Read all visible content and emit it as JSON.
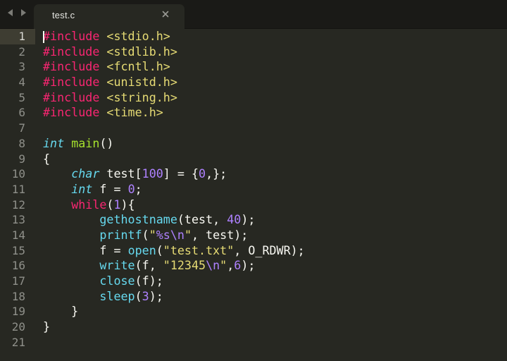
{
  "tab": {
    "title": "test.c",
    "close_glyph": "×"
  },
  "icons": {
    "back": "back-arrow-icon",
    "forward": "forward-arrow-icon",
    "close": "close-icon"
  },
  "editor": {
    "current_line": 1,
    "lines": [
      {
        "n": "1",
        "tokens": [
          {
            "t": "#include ",
            "c": "kw"
          },
          {
            "t": "<stdio.h>",
            "c": "str"
          }
        ]
      },
      {
        "n": "2",
        "tokens": [
          {
            "t": "#include ",
            "c": "kw"
          },
          {
            "t": "<stdlib.h>",
            "c": "str"
          }
        ]
      },
      {
        "n": "3",
        "tokens": [
          {
            "t": "#include ",
            "c": "kw"
          },
          {
            "t": "<fcntl.h>",
            "c": "str"
          }
        ]
      },
      {
        "n": "4",
        "tokens": [
          {
            "t": "#include ",
            "c": "kw"
          },
          {
            "t": "<unistd.h>",
            "c": "str"
          }
        ]
      },
      {
        "n": "5",
        "tokens": [
          {
            "t": "#include ",
            "c": "kw"
          },
          {
            "t": "<string.h>",
            "c": "str"
          }
        ]
      },
      {
        "n": "6",
        "tokens": [
          {
            "t": "#include ",
            "c": "kw"
          },
          {
            "t": "<time.h>",
            "c": "str"
          }
        ]
      },
      {
        "n": "7",
        "tokens": []
      },
      {
        "n": "8",
        "tokens": [
          {
            "t": "int",
            "c": "type"
          },
          {
            "t": " ",
            "c": "txt"
          },
          {
            "t": "main",
            "c": "fn"
          },
          {
            "t": "()",
            "c": "txt"
          }
        ]
      },
      {
        "n": "9",
        "tokens": [
          {
            "t": "{",
            "c": "txt"
          }
        ]
      },
      {
        "n": "10",
        "tokens": [
          {
            "t": "    ",
            "c": "txt"
          },
          {
            "t": "char",
            "c": "type"
          },
          {
            "t": " test[",
            "c": "txt"
          },
          {
            "t": "100",
            "c": "num"
          },
          {
            "t": "] = {",
            "c": "txt"
          },
          {
            "t": "0",
            "c": "num"
          },
          {
            "t": ",};",
            "c": "txt"
          }
        ]
      },
      {
        "n": "11",
        "tokens": [
          {
            "t": "    ",
            "c": "txt"
          },
          {
            "t": "int",
            "c": "type"
          },
          {
            "t": " f = ",
            "c": "txt"
          },
          {
            "t": "0",
            "c": "num"
          },
          {
            "t": ";",
            "c": "txt"
          }
        ]
      },
      {
        "n": "12",
        "tokens": [
          {
            "t": "    ",
            "c": "txt"
          },
          {
            "t": "while",
            "c": "kw"
          },
          {
            "t": "(",
            "c": "txt"
          },
          {
            "t": "1",
            "c": "num"
          },
          {
            "t": "){",
            "c": "txt"
          }
        ]
      },
      {
        "n": "13",
        "tokens": [
          {
            "t": "        ",
            "c": "txt"
          },
          {
            "t": "gethostname",
            "c": "call"
          },
          {
            "t": "(test, ",
            "c": "txt"
          },
          {
            "t": "40",
            "c": "num"
          },
          {
            "t": ");",
            "c": "txt"
          }
        ]
      },
      {
        "n": "14",
        "tokens": [
          {
            "t": "        ",
            "c": "txt"
          },
          {
            "t": "printf",
            "c": "call"
          },
          {
            "t": "(",
            "c": "txt"
          },
          {
            "t": "\"",
            "c": "str"
          },
          {
            "t": "%s\\n",
            "c": "num"
          },
          {
            "t": "\"",
            "c": "str"
          },
          {
            "t": ", test);",
            "c": "txt"
          }
        ]
      },
      {
        "n": "15",
        "tokens": [
          {
            "t": "        f = ",
            "c": "txt"
          },
          {
            "t": "open",
            "c": "call"
          },
          {
            "t": "(",
            "c": "txt"
          },
          {
            "t": "\"test.txt\"",
            "c": "str"
          },
          {
            "t": ", O_RDWR);",
            "c": "txt"
          }
        ]
      },
      {
        "n": "16",
        "tokens": [
          {
            "t": "        ",
            "c": "txt"
          },
          {
            "t": "write",
            "c": "call"
          },
          {
            "t": "(f, ",
            "c": "txt"
          },
          {
            "t": "\"12345",
            "c": "str"
          },
          {
            "t": "\\n",
            "c": "num"
          },
          {
            "t": "\"",
            "c": "str"
          },
          {
            "t": ",",
            "c": "txt"
          },
          {
            "t": "6",
            "c": "num"
          },
          {
            "t": ");",
            "c": "txt"
          }
        ]
      },
      {
        "n": "17",
        "tokens": [
          {
            "t": "        ",
            "c": "txt"
          },
          {
            "t": "close",
            "c": "call"
          },
          {
            "t": "(f);",
            "c": "txt"
          }
        ]
      },
      {
        "n": "18",
        "tokens": [
          {
            "t": "        ",
            "c": "txt"
          },
          {
            "t": "sleep",
            "c": "call"
          },
          {
            "t": "(",
            "c": "txt"
          },
          {
            "t": "3",
            "c": "num"
          },
          {
            "t": ");",
            "c": "txt"
          }
        ]
      },
      {
        "n": "19",
        "tokens": [
          {
            "t": "    }",
            "c": "txt"
          }
        ]
      },
      {
        "n": "20",
        "tokens": [
          {
            "t": "}",
            "c": "txt"
          }
        ]
      },
      {
        "n": "21",
        "tokens": []
      }
    ]
  },
  "colors": {
    "background": "#272822",
    "tabbar": "#1a1a17",
    "current_line": "#3e3d32",
    "keyword": "#f92672",
    "string": "#e6db74",
    "type": "#66d9ef",
    "function": "#a6e22e",
    "number": "#ae81ff",
    "text": "#f8f8f2",
    "gutter_text": "#8f908a"
  }
}
